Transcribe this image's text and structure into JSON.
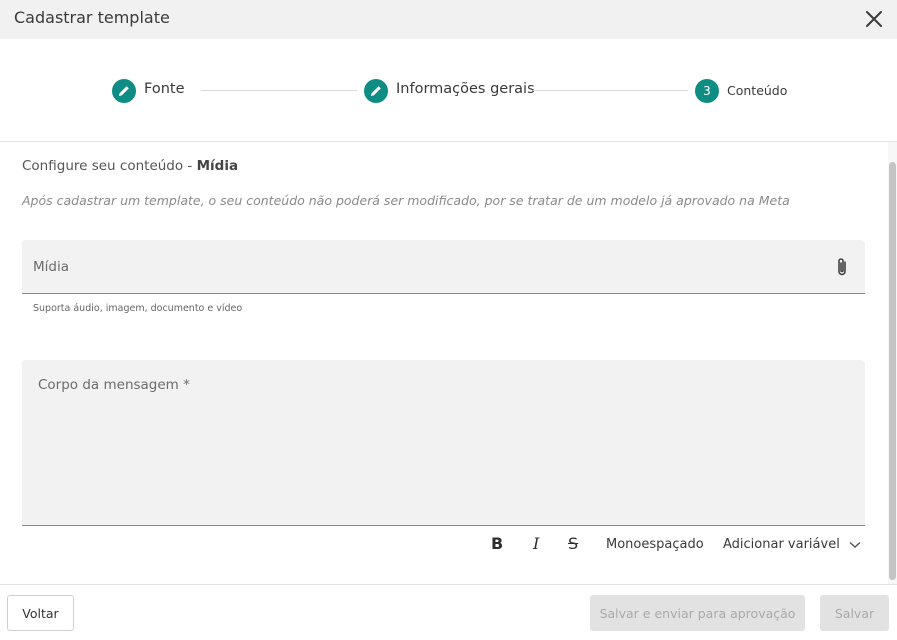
{
  "header": {
    "title": "Cadastrar template"
  },
  "stepper": {
    "steps": [
      {
        "label": "Fonte",
        "state": "completed",
        "icon": "pencil-icon"
      },
      {
        "label": "Informações gerais",
        "state": "completed",
        "icon": "pencil-icon"
      },
      {
        "label": "Conteúdo",
        "state": "current",
        "number": "3"
      }
    ]
  },
  "content": {
    "section_prefix": "Configure seu conteúdo - ",
    "section_type": "Mídia",
    "hint": "Após cadastrar um template, o seu conteúdo não poderá ser modificado, por se tratar de um modelo já aprovado na Meta",
    "media_field": {
      "label": "Mídia",
      "help": "Suporta áudio, imagem, documento e vídeo"
    },
    "body_field": {
      "placeholder": "Corpo da mensagem *"
    },
    "toolbar": {
      "bold": "B",
      "italic": "I",
      "strike": "S",
      "monospace": "Monoespaçado",
      "add_variable": "Adicionar variável"
    }
  },
  "footer": {
    "back": "Voltar",
    "submit": "Salvar e enviar para aprovação",
    "save": "Salvar"
  },
  "colors": {
    "accent": "#0f8c84",
    "disabled_bg": "#e2e2e2",
    "disabled_text": "#a9a9a9",
    "field_bg": "#f2f2f2"
  }
}
